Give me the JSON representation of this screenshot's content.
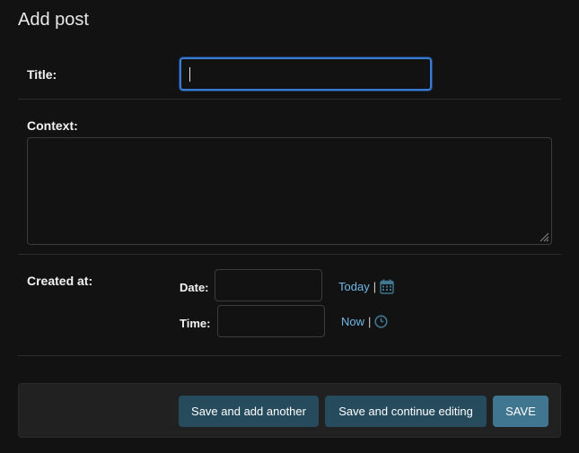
{
  "page": {
    "title": "Add post"
  },
  "form": {
    "title_field": {
      "label": "Title:",
      "value": ""
    },
    "context_field": {
      "label": "Context:",
      "value": ""
    },
    "created_at": {
      "label": "Created at:",
      "date": {
        "label": "Date:",
        "value": "",
        "shortcut": "Today",
        "separator": "|",
        "icon": "calendar-icon"
      },
      "time": {
        "label": "Time:",
        "value": "",
        "shortcut": "Now",
        "separator": "|",
        "icon": "clock-icon"
      }
    }
  },
  "actions": {
    "save_add_another": "Save and add another",
    "save_continue": "Save and continue editing",
    "save": "SAVE"
  },
  "colors": {
    "background": "#121212",
    "link": "#6fb7e8",
    "focus_border": "#3a7bd5",
    "button_secondary": "#264b5d",
    "button_primary": "#417690"
  }
}
